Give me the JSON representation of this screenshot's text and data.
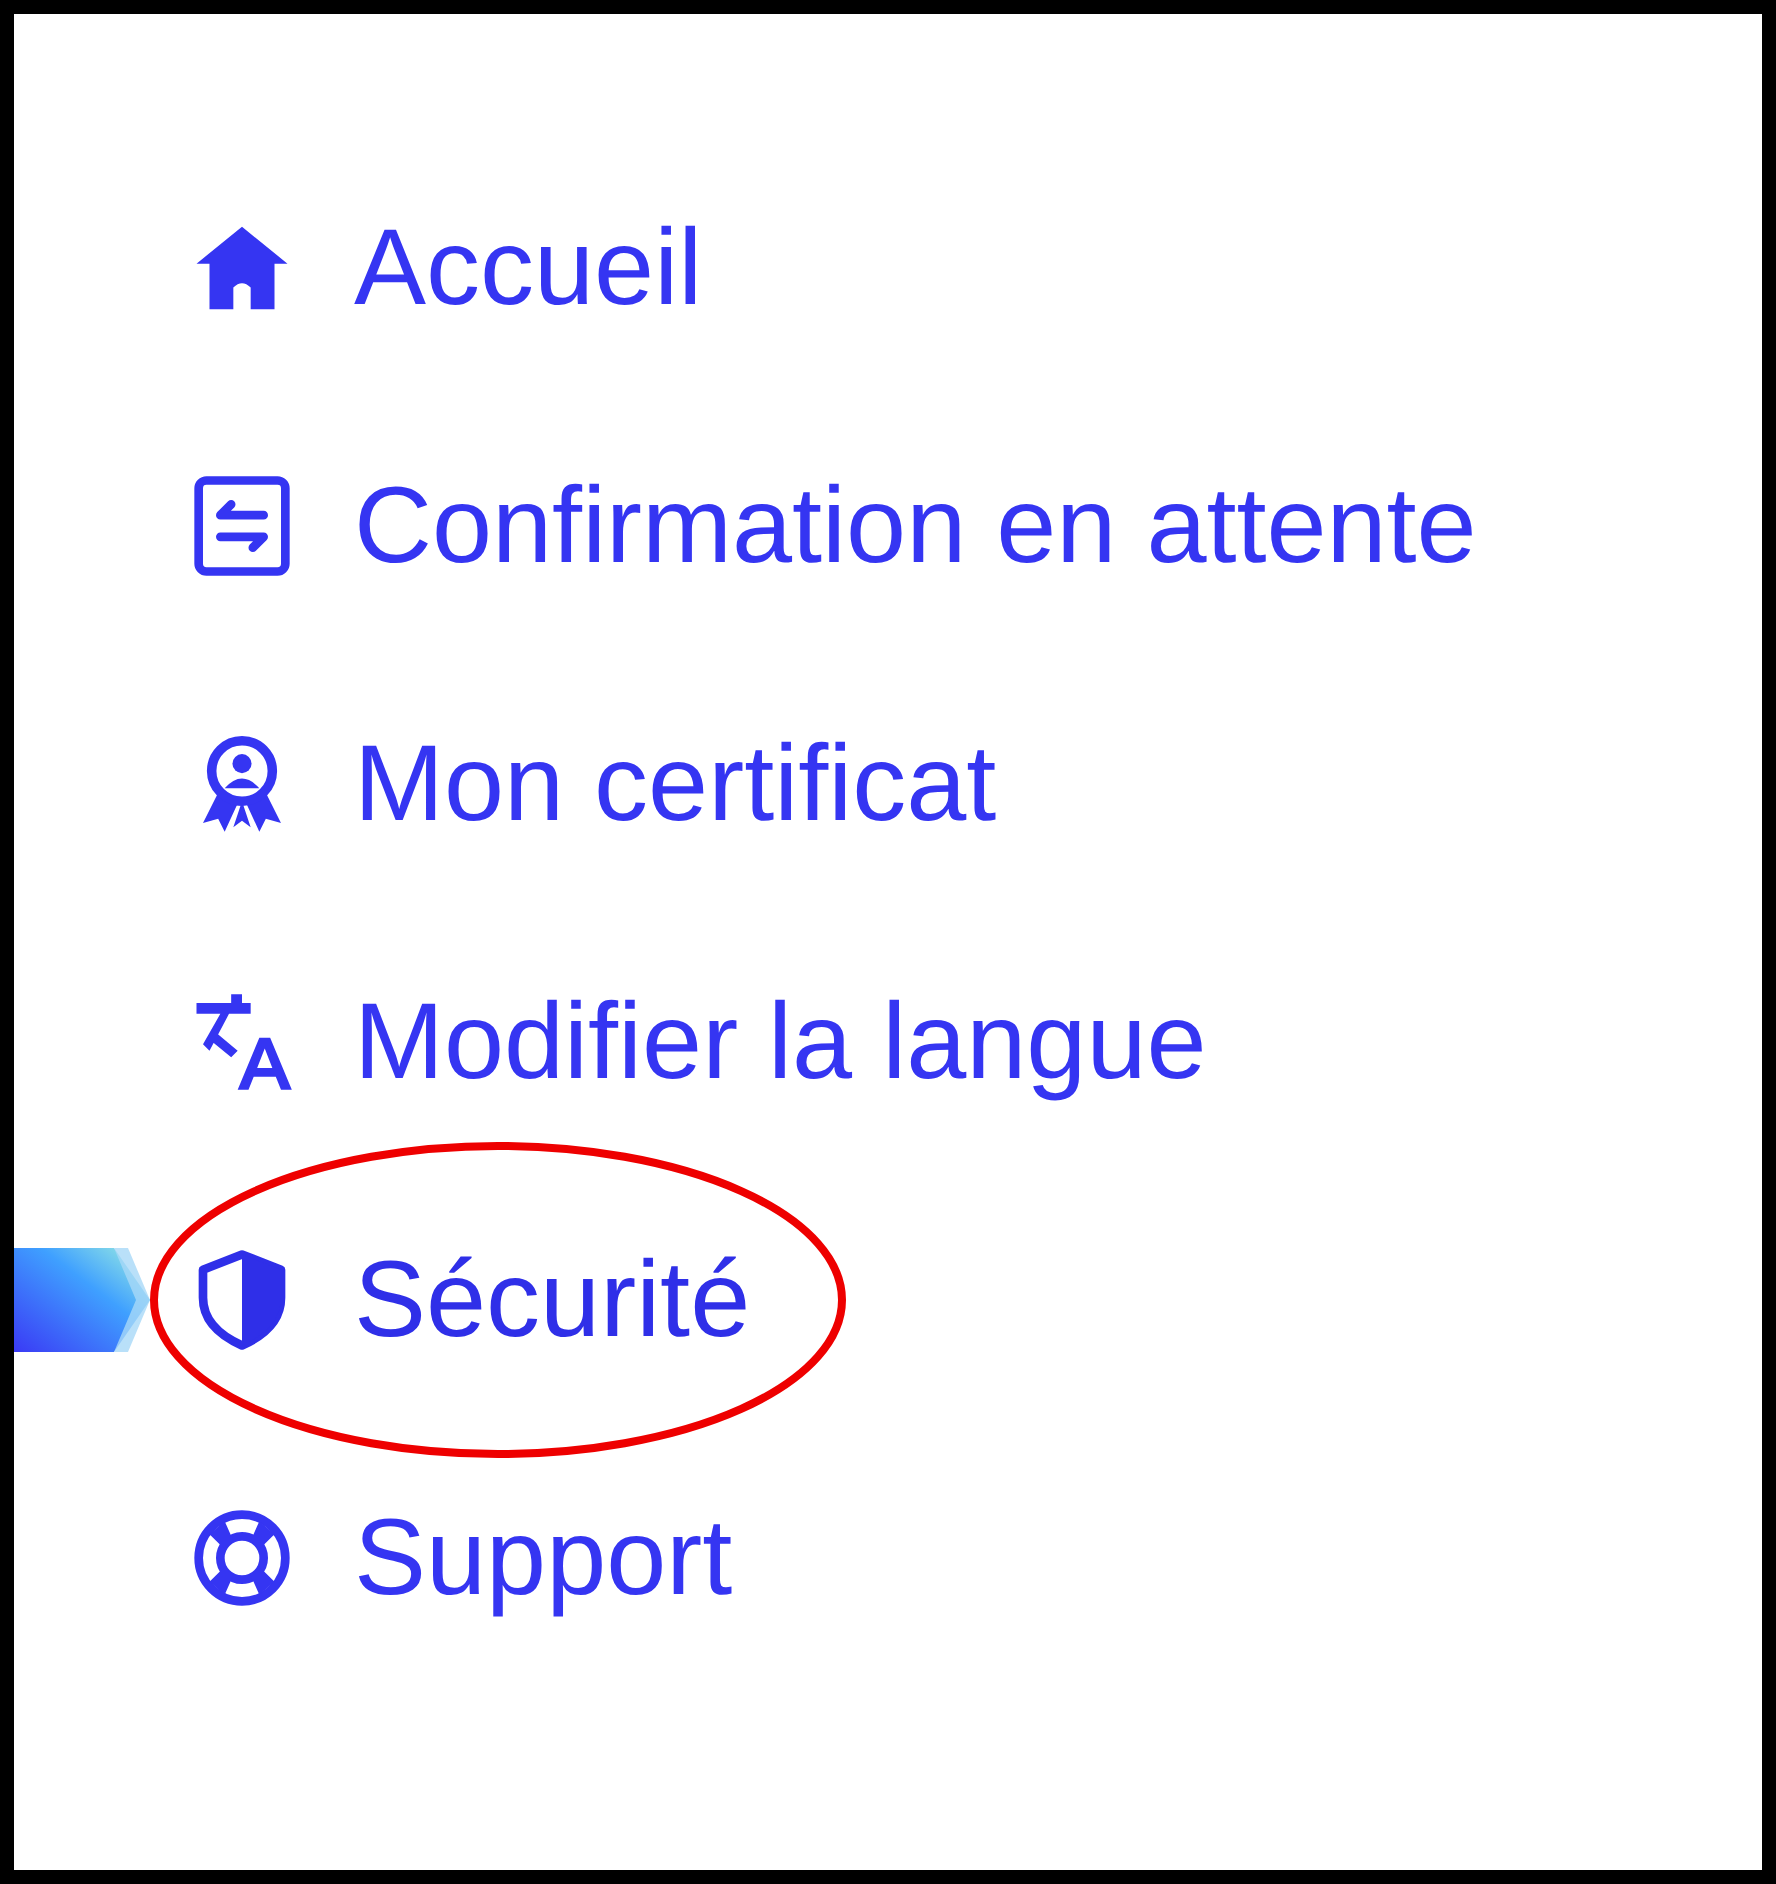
{
  "menu": {
    "items": [
      {
        "label": "Accueil",
        "selected": false,
        "circled": false
      },
      {
        "label": "Confirmation en attente",
        "selected": false,
        "circled": false
      },
      {
        "label": "Mon certificat",
        "selected": false,
        "circled": false
      },
      {
        "label": "Modifier la langue",
        "selected": false,
        "circled": false
      },
      {
        "label": "Sécurité",
        "selected": true,
        "circled": true
      },
      {
        "label": "Support",
        "selected": false,
        "circled": false
      }
    ]
  }
}
